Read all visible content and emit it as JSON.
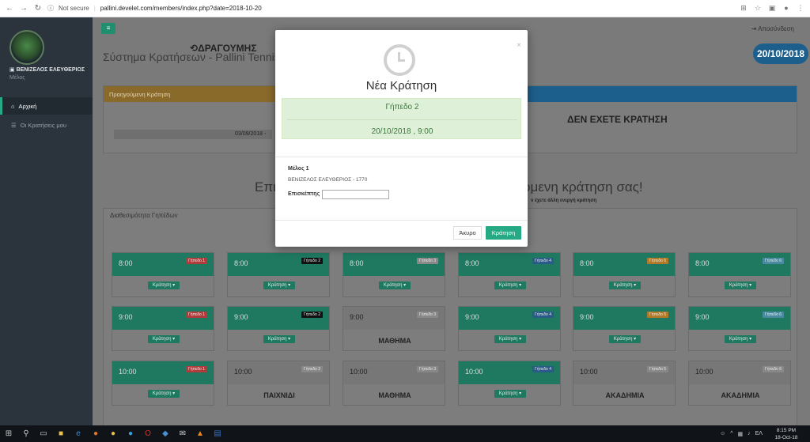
{
  "browser": {
    "security": "Not secure",
    "url": "pallini.develet.com/members/index.php?date=2018-10-20"
  },
  "sidebar": {
    "user_name": "ΒΕΝΙΖΕΛΟΣ ΕΛΕΥΘΕΡΙΟΣ",
    "user_role": "Μέλος",
    "items": [
      {
        "label": "Αρχική"
      },
      {
        "label": "Οι Κρατήσεις μου"
      }
    ]
  },
  "header": {
    "logout": "Αποσύνδεση",
    "title": "Σύστημα Κρατήσεων - Pallini Tennis Pa",
    "date_badge": "20/10/2018"
  },
  "prev_panel": {
    "header": "Προηγούμενη Κράτηση",
    "name": "ΔΡΑΓΟΥΜΗΣ",
    "date": "03/09/2018  -"
  },
  "next_panel": {
    "text": "ΔΕΝ ΕΧΕΤΕ ΚΡΑΤΗΣΗ"
  },
  "promo": {
    "left": "Επιλ",
    "right": "όμενη κράτηση σας!",
    "sub": "ν έχετε άλλη ενεργή κράτηση"
  },
  "availability": {
    "title": "Διαθεσιμότητα Γηπέδων",
    "action_label": "Κράτηση ▾",
    "rows": [
      {
        "time": "8:00",
        "courts": [
          {
            "tag": "Γήπεδο 1",
            "state": "avail",
            "tag_color": "#b33a3a"
          },
          {
            "tag": "Γήπεδο 2",
            "state": "avail",
            "tag_color": "#111111"
          },
          {
            "tag": "Γήπεδο 3",
            "state": "avail",
            "tag_color": "#888888"
          },
          {
            "tag": "Γήπεδο 4",
            "state": "avail",
            "tag_color": "#2a5a8a"
          },
          {
            "tag": "Γήπεδο 5",
            "state": "avail",
            "tag_color": "#b07a2a"
          },
          {
            "tag": "Γήπεδο 6",
            "state": "avail",
            "tag_color": "#4a8aa0"
          }
        ]
      },
      {
        "time": "9:00",
        "courts": [
          {
            "tag": "Γήπεδο 1",
            "state": "avail",
            "tag_color": "#b33a3a"
          },
          {
            "tag": "Γήπεδο 2",
            "state": "avail",
            "tag_color": "#111111"
          },
          {
            "tag": "Γήπεδο 3",
            "state": "gray",
            "status": "ΜΑΘΗΜΑ",
            "tag_color": "#888888"
          },
          {
            "tag": "Γήπεδο 4",
            "state": "avail",
            "tag_color": "#2a5a8a"
          },
          {
            "tag": "Γήπεδο 5",
            "state": "avail",
            "tag_color": "#b07a2a"
          },
          {
            "tag": "Γήπεδο 6",
            "state": "avail",
            "tag_color": "#4a8aa0"
          }
        ]
      },
      {
        "time": "10:00",
        "courts": [
          {
            "tag": "Γήπεδο 1",
            "state": "avail",
            "tag_color": "#b33a3a"
          },
          {
            "tag": "Γήπεδο 2",
            "state": "gray",
            "status": "ΠΑΙΧΝΙΔΙ",
            "tag_color": "#888888"
          },
          {
            "tag": "Γήπεδο 3",
            "state": "gray",
            "status": "ΜΑΘΗΜΑ",
            "tag_color": "#888888"
          },
          {
            "tag": "Γήπεδο 4",
            "state": "avail",
            "tag_color": "#2a5a8a"
          },
          {
            "tag": "Γήπεδο 5",
            "state": "gray",
            "status": "ΑΚΑΔΗΜΙΑ",
            "tag_color": "#888888"
          },
          {
            "tag": "Γήπεδο 6",
            "state": "gray",
            "status": "ΑΚΑΔΗΜΙΑ",
            "tag_color": "#888888"
          }
        ]
      }
    ]
  },
  "modal": {
    "title": "Νέα Κράτηση",
    "court": "Γήπεδο  2",
    "datetime": "20/10/2018 ,    9:00",
    "member_label": "Μέλος 1",
    "member_value": "ΒΕΝΙΖΕΛΟΣ ΕΛΕΥΘΕΡΙΟΣ - 1770",
    "visitor_label": "Επισκέπτης",
    "visitor_value": "",
    "cancel": "Άκυρο",
    "book": "Κράτηση",
    "close": "×"
  },
  "taskbar": {
    "lang": "ΕΛ",
    "time": "8:15 PM",
    "date": "18-Oct-18"
  }
}
